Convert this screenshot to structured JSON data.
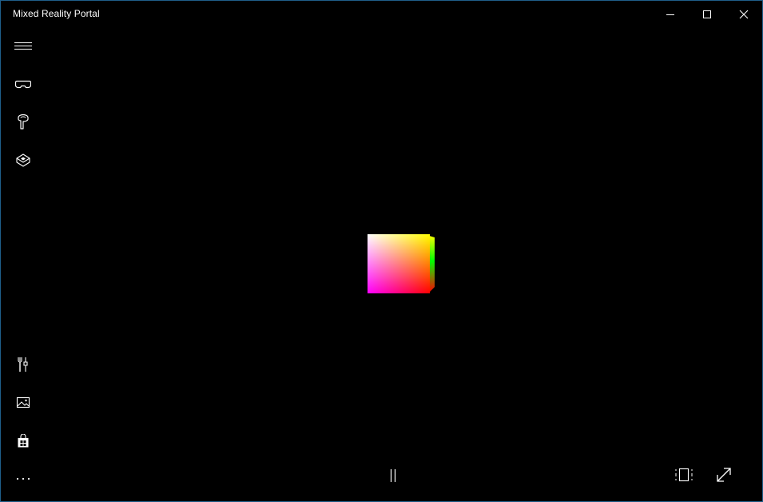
{
  "window": {
    "title": "Mixed Reality Portal"
  },
  "caption_buttons": [
    "minimize",
    "maximize",
    "close"
  ],
  "nav": {
    "top_items": [
      {
        "icon": "hamburger-menu-icon"
      },
      {
        "icon": "headset-icon"
      },
      {
        "icon": "motion-controller-icon"
      },
      {
        "icon": "boundary-setup-icon"
      }
    ],
    "bottom_items": [
      {
        "icon": "tools-icon"
      },
      {
        "icon": "photos-icon"
      },
      {
        "icon": "store-icon"
      },
      {
        "icon": "more-icon"
      }
    ]
  },
  "viewport": {
    "object": "color-cube",
    "colors": {
      "white": "#ffffff",
      "yellow": "#ffff00",
      "magenta": "#ff00ff",
      "red": "#ff0000",
      "green": "#00ff00"
    }
  },
  "controls": {
    "pause": {
      "icon": "pause-icon"
    },
    "view_mode": {
      "icon": "view-mode-icon"
    },
    "fullscreen": {
      "icon": "expand-icon"
    }
  },
  "theme": {
    "border": "#1f5f8a",
    "background": "#000000",
    "foreground": "#ffffff"
  }
}
